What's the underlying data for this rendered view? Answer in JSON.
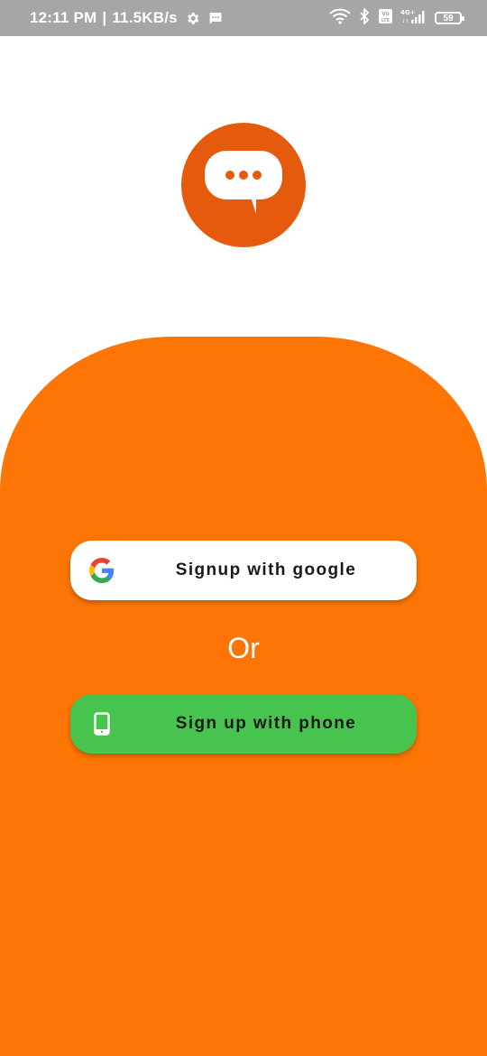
{
  "status_bar": {
    "time": "12:11 PM",
    "separator": "|",
    "network_speed": "11.5KB/s",
    "battery_level": "59",
    "icons": [
      "settings-gear-icon",
      "message-icon",
      "wifi-icon",
      "bluetooth-icon",
      "volte-icon",
      "signal-4g-icon",
      "battery-icon"
    ]
  },
  "logo": {
    "icon": "chat-bubble-icon",
    "color": "#e65a0d"
  },
  "colors": {
    "panel": "#fd7605",
    "google_button": "#ffffff",
    "phone_button": "#46c44e"
  },
  "auth": {
    "google_button_label": "Signup with google",
    "google_icon": "google-logo-icon",
    "or_label": "Or",
    "phone_button_label": "Sign up with phone",
    "phone_icon": "smartphone-icon"
  }
}
